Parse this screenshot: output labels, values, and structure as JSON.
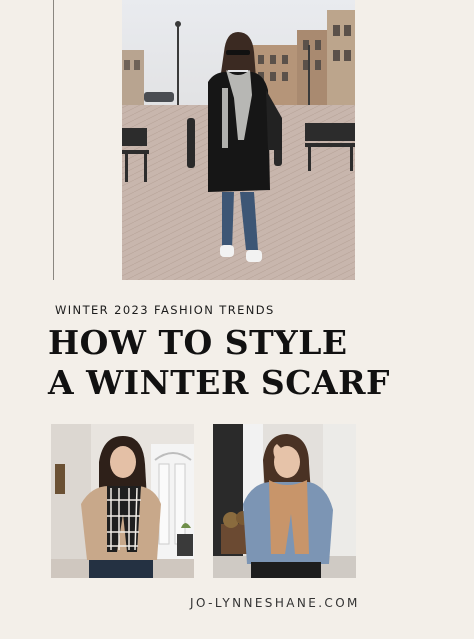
{
  "kicker": "WINTER 2023 FASHION TRENDS",
  "headline": {
    "line1": "HOW TO STYLE",
    "line2": "A WINTER SCARF"
  },
  "website": "JO-LYNNESHANE.COM",
  "colors": {
    "background": "#f3efe9",
    "text": "#111111",
    "rule": "#8a8680"
  },
  "photos": {
    "top": {
      "subject": "woman-black-coat-grey-scarf-street"
    },
    "bottom_left": {
      "subject": "woman-plaid-scarf-indoors"
    },
    "bottom_right": {
      "subject": "woman-camel-scarf-denim-jacket"
    }
  }
}
